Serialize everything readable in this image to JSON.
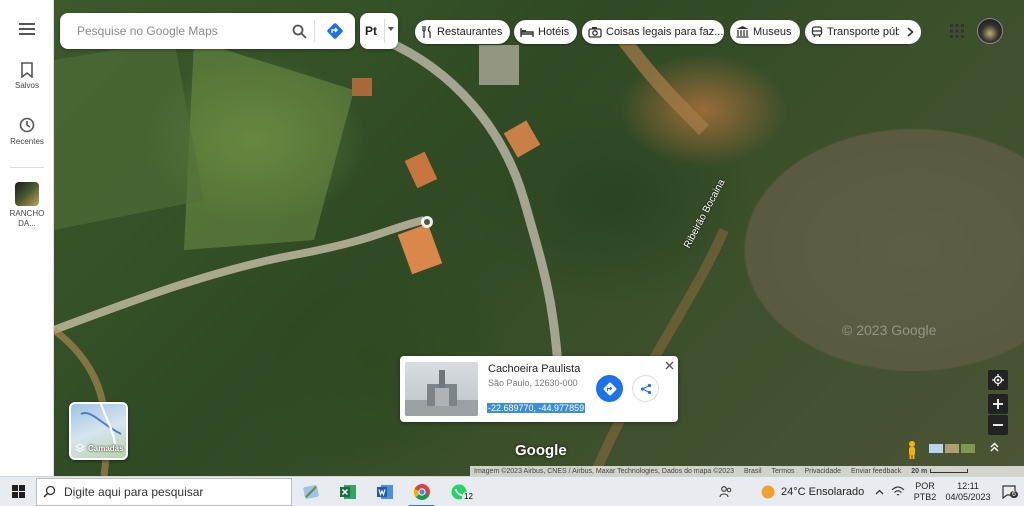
{
  "rail": {
    "menu_icon": "hamburger-icon",
    "saved_label": "Salvos",
    "recent_label": "Recentes",
    "place_label": "RANCHO DA..."
  },
  "search": {
    "placeholder": "Pesquise no Google Maps"
  },
  "lang_button": {
    "label": "Pt"
  },
  "chips": [
    {
      "label": "Restaurantes",
      "icon": "fork-knife-icon"
    },
    {
      "label": "Hotéis",
      "icon": "bed-icon"
    },
    {
      "label": "Coisas legais para faz...",
      "icon": "camera-icon"
    },
    {
      "label": "Museus",
      "icon": "museum-icon"
    },
    {
      "label": "Transporte púb",
      "icon": "transit-icon"
    }
  ],
  "map": {
    "river_label": "Ribeirão Bocaina",
    "road_label": "...Bo... ra",
    "watermark": "© 2023 Google",
    "google_logo": "Google",
    "layers_label": "Camadas"
  },
  "card": {
    "title": "Cachoeira Paulista",
    "subtitle": "São Paulo, 12630-000",
    "coords": "-22.689770, -44.977859"
  },
  "attribution": {
    "imagery": "Imagem ©2023 Airbus, CNES / Airbus, Maxar Technologies, Dados do mapa ©2023",
    "brasil": "Brasil",
    "terms": "Termos",
    "privacy": "Privacidade",
    "feedback": "Enviar feedback",
    "scale": "20 m"
  },
  "taskbar": {
    "search_placeholder": "Digite aqui para pesquisar",
    "whatsapp_badge": "12",
    "weather": "24°C  Ensolarado",
    "lang1": "POR",
    "lang2": "PTB2",
    "time": "12:11",
    "date": "04/05/2023",
    "notif_count": "6"
  },
  "colors": {
    "accent": "#1a73e8",
    "coords_highlight": "#3b8fd6"
  }
}
